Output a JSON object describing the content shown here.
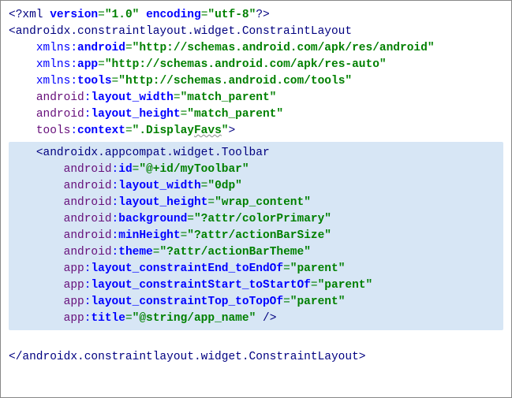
{
  "xml_decl": {
    "open": "<?",
    "target": "xml",
    "attrs": [
      {
        "name": "version",
        "value": "\"1.0\""
      },
      {
        "name": "encoding",
        "value": "\"utf-8\""
      }
    ],
    "close": "?>"
  },
  "root": {
    "open": "<",
    "name": "androidx.constraintlayout.widget.ConstraintLayout",
    "attrs": [
      {
        "ns": "xmlns",
        "local": "android",
        "value": "\"http://schemas.android.com/apk/res/android\""
      },
      {
        "ns": "xmlns",
        "local": "app",
        "value": "\"http://schemas.android.com/apk/res-auto\""
      },
      {
        "ns": "xmlns",
        "local": "tools",
        "value": "\"http://schemas.android.com/tools\""
      },
      {
        "ns": "android",
        "local": "layout_width",
        "value": "\"match_parent\""
      },
      {
        "ns": "android",
        "local": "layout_height",
        "value": "\"match_parent\""
      },
      {
        "ns": "tools",
        "local": "context",
        "value_pre": "\".Display",
        "value_wavy": "Favs",
        "value_post": "\"",
        "wavy": true
      }
    ],
    "close_open": ">",
    "close_tag": "</androidx.constraintlayout.widget.ConstraintLayout>"
  },
  "toolbar": {
    "open": "<",
    "name": "androidx.appcompat.widget.Toolbar",
    "attrs": [
      {
        "ns": "android",
        "local": "id",
        "value": "\"@+id/myToolbar\""
      },
      {
        "ns": "android",
        "local": "layout_width",
        "value": "\"0dp\""
      },
      {
        "ns": "android",
        "local": "layout_height",
        "value": "\"wrap_content\""
      },
      {
        "ns": "android",
        "local": "background",
        "value": "\"?attr/colorPrimary\""
      },
      {
        "ns": "android",
        "local": "minHeight",
        "value": "\"?attr/actionBarSize\""
      },
      {
        "ns": "android",
        "local": "theme",
        "value": "\"?attr/actionBarTheme\""
      },
      {
        "ns": "app",
        "local": "layout_constraintEnd_toEndOf",
        "value": "\"parent\""
      },
      {
        "ns": "app",
        "local": "layout_constraintStart_toStartOf",
        "value": "\"parent\""
      },
      {
        "ns": "app",
        "local": "layout_constraintTop_toTopOf",
        "value": "\"parent\""
      },
      {
        "ns": "app",
        "local": "title",
        "value": "\"@string/app_name\""
      }
    ],
    "self_close": " />"
  },
  "indent1": "    ",
  "indent2": "        "
}
